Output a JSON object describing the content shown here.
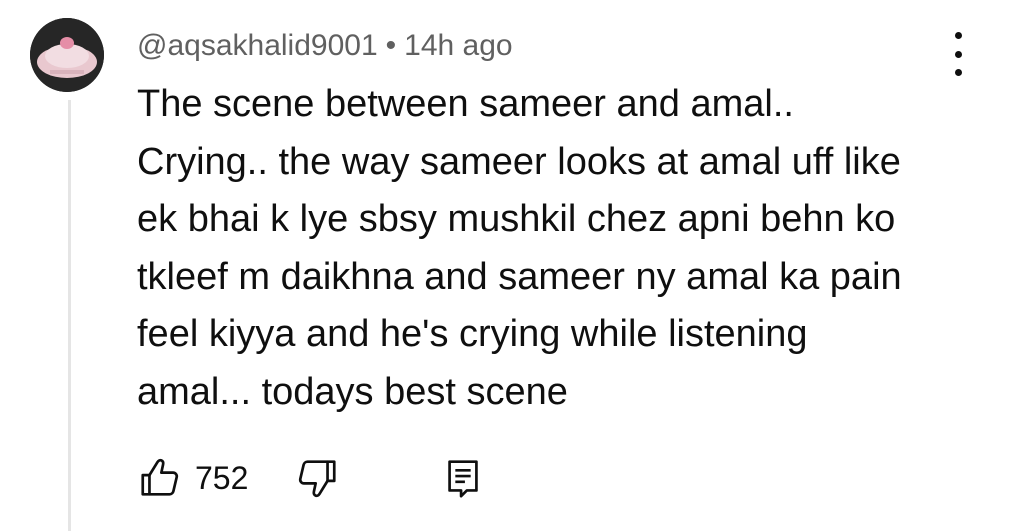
{
  "comment": {
    "author": "@aqsakhalid9001",
    "separator": "•",
    "time": "14h ago",
    "lines": [
      "The scene between sameer and amal..",
      "Crying.. the way sameer looks at amal uff like",
      "ek bhai k lye sbsy mushkil chez apni behn ko",
      "tkleef m daikhna and sameer ny amal ka pain",
      "feel kiyya and he's crying while listening",
      "amal... todays best scene"
    ]
  },
  "actions": {
    "like_icon": "thumbs-up-icon",
    "like_count": "752",
    "dislike_icon": "thumbs-down-icon",
    "reply_icon": "reply-icon",
    "more_icon": "vertical-ellipsis-icon"
  },
  "colors": {
    "text": "#0f0f0f",
    "meta": "#606060",
    "thread_line": "#e5e5e5"
  }
}
